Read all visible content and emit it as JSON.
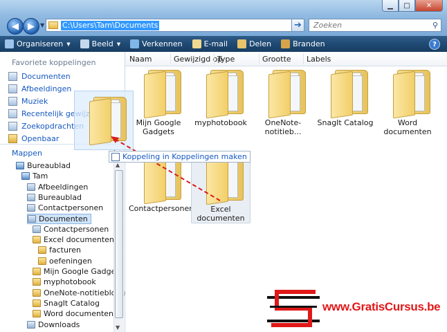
{
  "window": {
    "minimize": "▁",
    "maximize": "□",
    "close": "✕"
  },
  "address": {
    "path": "C:\\Users\\Tam\\Documents"
  },
  "search": {
    "placeholder": "Zoeken"
  },
  "toolbar": {
    "items": [
      {
        "label": "Organiseren",
        "icon": "organize-icon",
        "color": "#9dc3ea",
        "dropdown": true
      },
      {
        "label": "Beeld",
        "icon": "view-icon",
        "color": "#c6d8ec",
        "dropdown": true
      },
      {
        "label": "Verkennen",
        "icon": "explore-icon",
        "color": "#7fb7e6",
        "dropdown": false
      },
      {
        "label": "E-mail",
        "icon": "email-icon",
        "color": "#f0d890",
        "dropdown": false
      },
      {
        "label": "Delen",
        "icon": "share-icon",
        "color": "#e8c36a",
        "dropdown": false
      },
      {
        "label": "Branden",
        "icon": "burn-icon",
        "color": "#d7a44c",
        "dropdown": false
      }
    ],
    "help": "?"
  },
  "favorites": {
    "header": "Favoriete koppelingen",
    "items": [
      "Documenten",
      "Afbeeldingen",
      "Muziek",
      "Recentelijk gewijzigd",
      "Zoekopdrachten",
      "Openbaar"
    ]
  },
  "folders": {
    "header": "Mappen",
    "tree": [
      {
        "label": "Bureaublad",
        "level": 0,
        "kind": "pc"
      },
      {
        "label": "Tam",
        "level": 1,
        "kind": "pc"
      },
      {
        "label": "Afbeeldingen",
        "level": 2,
        "kind": "doc"
      },
      {
        "label": "Bureaublad",
        "level": 2,
        "kind": "doc"
      },
      {
        "label": "Contactpersonen",
        "level": 2,
        "kind": "doc"
      },
      {
        "label": "Documenten",
        "level": 2,
        "kind": "doc",
        "selected": true
      },
      {
        "label": "Contactpersonen",
        "level": 3,
        "kind": "doc"
      },
      {
        "label": "Excel documenten",
        "level": 3,
        "kind": "folder"
      },
      {
        "label": "facturen",
        "level": 4,
        "kind": "folder"
      },
      {
        "label": "oefeningen",
        "level": 4,
        "kind": "folder"
      },
      {
        "label": "Mijn Google Gadgets",
        "level": 3,
        "kind": "folder"
      },
      {
        "label": "myphotobook",
        "level": 3,
        "kind": "folder"
      },
      {
        "label": "OneNote-notitieblokken",
        "level": 3,
        "kind": "folder"
      },
      {
        "label": "SnagIt Catalog",
        "level": 3,
        "kind": "folder"
      },
      {
        "label": "Word documenten",
        "level": 3,
        "kind": "folder"
      },
      {
        "label": "Downloads",
        "level": 2,
        "kind": "doc"
      }
    ]
  },
  "columns": [
    "Naam",
    "Gewijzigd op",
    "Type",
    "Grootte",
    "Labels"
  ],
  "files": [
    {
      "name": "Mijn Google Gadgets"
    },
    {
      "name": "myphotobook"
    },
    {
      "name": "OneNote-notitieb..."
    },
    {
      "name": "SnagIt Catalog"
    },
    {
      "name": "Word documenten"
    },
    {
      "name": "Contactpersonen"
    },
    {
      "name": "Excel documenten",
      "highlighted": true
    }
  ],
  "drag": {
    "tooltip": "Koppeling in Koppelingen maken"
  },
  "watermark": {
    "text": "www.GratisCursus.be"
  },
  "colors": {
    "accent": "#1558c0",
    "toolbar": "#1f4a74",
    "brand_red": "#e01818"
  }
}
